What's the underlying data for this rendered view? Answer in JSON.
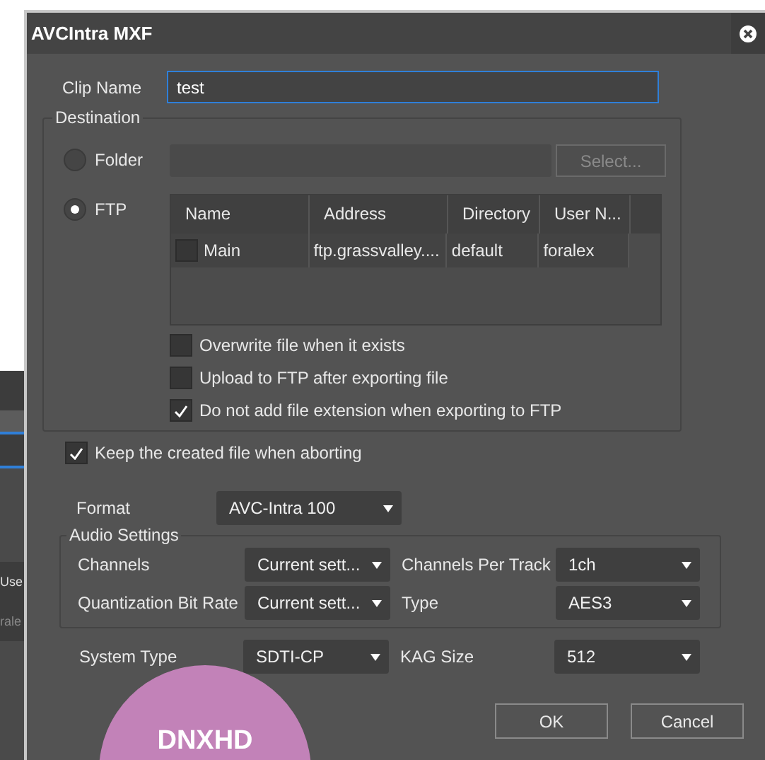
{
  "window": {
    "title": "AVCIntra MXF"
  },
  "clip_name": {
    "label": "Clip Name",
    "value": "test"
  },
  "destination": {
    "title": "Destination",
    "options": [
      {
        "label": "Folder",
        "selected": false
      },
      {
        "label": "FTP",
        "selected": true
      }
    ],
    "select_button": "Select...",
    "ftp_table": {
      "columns": [
        "Name",
        "Address",
        "Directory",
        "User N..."
      ],
      "rows": [
        {
          "checked": false,
          "cells": [
            "Main",
            "ftp.grassvalley....",
            "default",
            "foralex"
          ]
        }
      ]
    },
    "checkboxes": [
      {
        "label": "Overwrite file when it exists",
        "checked": false
      },
      {
        "label": "Upload to FTP after exporting file",
        "checked": false
      },
      {
        "label": "Do not add file extension when exporting to FTP",
        "checked": true
      }
    ]
  },
  "keep_file": {
    "label": "Keep the created file when aborting",
    "checked": true
  },
  "format": {
    "label": "Format",
    "value": "AVC-Intra 100"
  },
  "audio_settings": {
    "title": "Audio Settings",
    "fields": [
      {
        "label": "Channels",
        "value": "Current sett..."
      },
      {
        "label": "Channels Per Track",
        "value": "1ch"
      },
      {
        "label": "Quantization Bit Rate",
        "value": "Current sett..."
      },
      {
        "label": "Type",
        "value": "AES3"
      }
    ]
  },
  "system": [
    {
      "label": "System Type",
      "value": "SDTI-CP"
    },
    {
      "label": "KAG Size",
      "value": "512"
    }
  ],
  "buttons": [
    "OK",
    "Cancel"
  ],
  "background_window": {
    "texts": [
      "Use",
      "rale"
    ]
  },
  "badge": {
    "text": "DNXHD"
  }
}
